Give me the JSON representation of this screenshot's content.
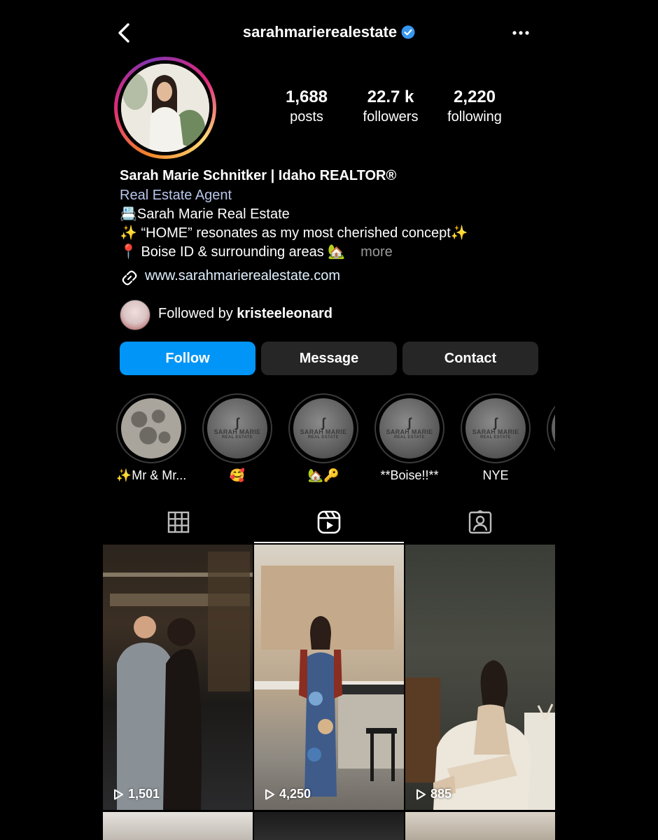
{
  "header": {
    "username": "sarahmarierealestate"
  },
  "stats": {
    "posts_count": "1,688",
    "posts_label": "posts",
    "followers_count": "22.7 k",
    "followers_label": "followers",
    "following_count": "2,220",
    "following_label": "following"
  },
  "bio": {
    "name": "Sarah Marie Schnitker | Idaho REALTOR®",
    "category": "Real Estate Agent",
    "line1": "📇Sarah Marie Real Estate",
    "line2": "✨ “HOME” resonates as my most cherished concept✨",
    "line3": "📍 Boise ID & surrounding areas 🏡",
    "more": "more",
    "link": "www.sarahmarierealestate.com"
  },
  "followed_by": {
    "prefix": "Followed by ",
    "user": "kristeeleonard"
  },
  "actions": {
    "follow": "Follow",
    "message": "Message",
    "contact": "Contact"
  },
  "highlights": [
    {
      "label": "✨Mr & Mr..."
    },
    {
      "label": "🥰",
      "logo_line1": "SARAH MARIE",
      "logo_line2": "REAL ESTATE"
    },
    {
      "label": "🏡🔑",
      "logo_line1": "SARAH MARIE",
      "logo_line2": "REAL ESTATE"
    },
    {
      "label": "**Boise!!**",
      "logo_line1": "SARAH MARIE",
      "logo_line2": "REAL ESTATE"
    },
    {
      "label": "NYE",
      "logo_line1": "SARAH MARIE",
      "logo_line2": "REAL ESTATE"
    }
  ],
  "tabs": {
    "active": "reels"
  },
  "reels": [
    {
      "views": "1,501"
    },
    {
      "views": "4,250"
    },
    {
      "views": "885"
    }
  ],
  "colors": {
    "accent": "#0095f6",
    "verified": "#3897f0",
    "button_secondary": "#262626"
  }
}
